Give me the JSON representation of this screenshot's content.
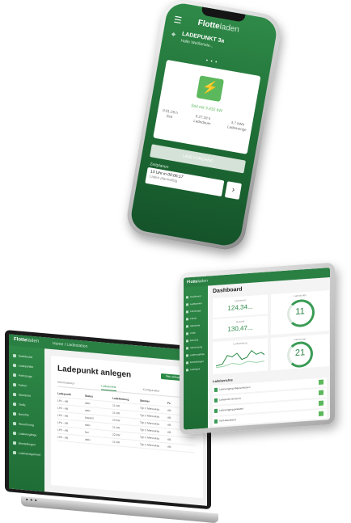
{
  "brand": {
    "logo_part1": "Flotte",
    "logo_part2": "laden"
  },
  "phone": {
    "menu_icon": "☰",
    "location_icon": "⌖",
    "station_name": "LADEPUNKT 3a",
    "station_address": "Halle Weißenste...",
    "pager": "• • •",
    "plug_icon": "⚡",
    "since_text": "Seit mit 3.432 kW",
    "stats": [
      {
        "value": "0:01:28 h",
        "label": "Zeit"
      },
      {
        "value": "0:27:28 h",
        "label": "Ladedauer"
      },
      {
        "value": "3,7 kWh",
        "label": "Lademenge"
      }
    ],
    "button_label": "LADEVORGANG",
    "schedule_label": "Zeitplanen",
    "schedule_time": "13 Uhr in 00:06:17",
    "schedule_sub": "Laden planmäßig",
    "arrow_icon": "›"
  },
  "laptop": {
    "breadcrumb": "Home  /  Ladestation",
    "nav": [
      "Dashboard",
      "Ladepunkte",
      "Fahrzeuge",
      "Fahrer",
      "Standorte",
      "Tarife",
      "Berichte",
      "Abrechnung",
      "Ladevorgänge",
      "Einstellungen",
      "Lastmanagement"
    ],
    "title": "Ladepunkt anlegen",
    "new_button": "Neu anlegen",
    "tabs": [
      "Informationen",
      "Ladepunkte",
      "Konfiguration",
      "Details"
    ],
    "active_tab": 1,
    "columns": [
      "Ladepunkt",
      "Status",
      "Ladeleistung",
      "Stecker",
      "Fz."
    ],
    "rows": [
      [
        "LP1 - AB",
        "aktiv",
        "11 kW",
        "Typ 2 Mennekes",
        "AB"
      ],
      [
        "LP2 - AB",
        "aktiv",
        "11 kW",
        "Typ 2 Mennekes",
        "AB"
      ],
      [
        "LP3 - AB",
        "besetzt",
        "22 kW",
        "Typ 2 Mennekes",
        "AB"
      ],
      [
        "LP4 - AB",
        "aktiv",
        "11 kW",
        "Typ 2 Mennekes",
        "AB"
      ],
      [
        "LP5 - AB",
        "frei",
        "22 kW",
        "Typ 2 Mennekes",
        "AB"
      ],
      [
        "LP6 - AB",
        "aktiv",
        "11 kW",
        "Typ 2 Mennekes",
        "AB"
      ]
    ],
    "keys": "■ ■ ■"
  },
  "tablet": {
    "nav": [
      "Dashboard",
      "Ladepunkte",
      "Fahrzeuge",
      "Fahrer",
      "Standorte",
      "Tarife",
      "Berichte",
      "Abrechnung",
      "Ladevorgänge",
      "Einstellungen",
      "Lastmgmt"
    ],
    "title": "Dashboard",
    "kpi1_label": "Ladestrom",
    "kpi1_value": "124,34...",
    "kpi2_label": "Gesamt",
    "kpi2_value": "130,47...",
    "ring1_label": "Ladepunkte",
    "ring1_value": "11",
    "ring2_label": "Fahrzeuge",
    "ring2_value": "21",
    "chart_label": "Ladeleistung",
    "section_label": "Ladeberichte",
    "list": [
      "Ladevorgang abgeschlossen",
      "Ladepunkt 3a bereit",
      "Ladevorgang gestartet",
      "Tarif aktualisiert"
    ]
  },
  "colors": {
    "brand_green": "#2a8a45",
    "dark_green": "#1d6b34",
    "light_green": "#5cb85c"
  }
}
